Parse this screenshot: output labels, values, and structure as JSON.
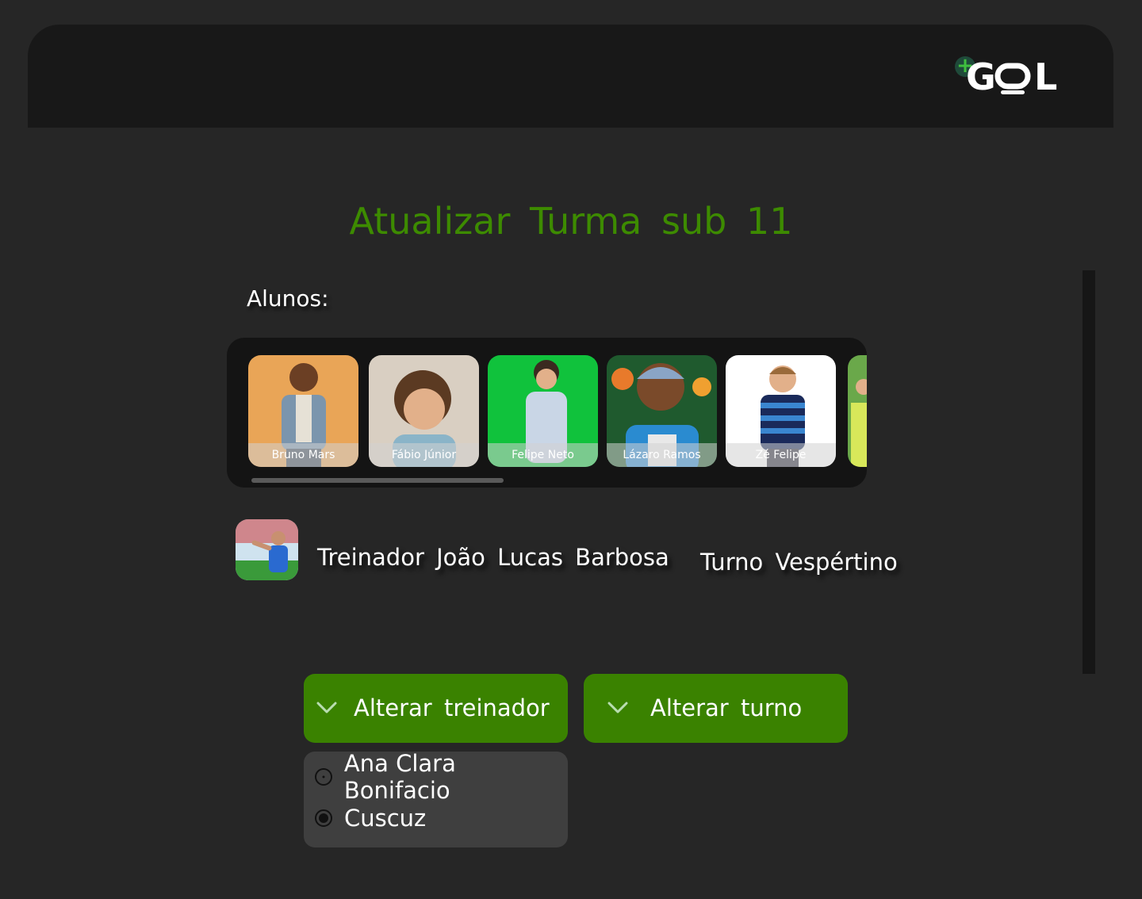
{
  "header": {
    "logo_text": "G⊝L",
    "logo_plus": "+"
  },
  "page": {
    "title": "Atualizar Turma sub 11"
  },
  "students": {
    "label": "Alunos:",
    "items": [
      {
        "name": "Bruno Mars",
        "bg": "#e9a557"
      },
      {
        "name": "Fábio Júnior",
        "bg": "#d9cfc2"
      },
      {
        "name": "Felipe Neto",
        "bg": "#10c23c"
      },
      {
        "name": "Lázaro Ramos",
        "bg": "#1f5a2e"
      },
      {
        "name": "Zé Felipe",
        "bg": "#ffffff"
      }
    ]
  },
  "coach": {
    "label": "Treinador João Lucas Barbosa"
  },
  "shift": {
    "label": "Turno Vespértino"
  },
  "actions": {
    "change_coach": "Alterar treinador",
    "change_shift": "Alterar turno"
  },
  "coach_options": [
    {
      "label": "Ana Clara Bonifacio",
      "selected": false
    },
    {
      "label": "Cuscuz",
      "selected": true
    }
  ],
  "colors": {
    "accent": "#3a8200",
    "title": "#3d8b00",
    "background": "#262626"
  }
}
